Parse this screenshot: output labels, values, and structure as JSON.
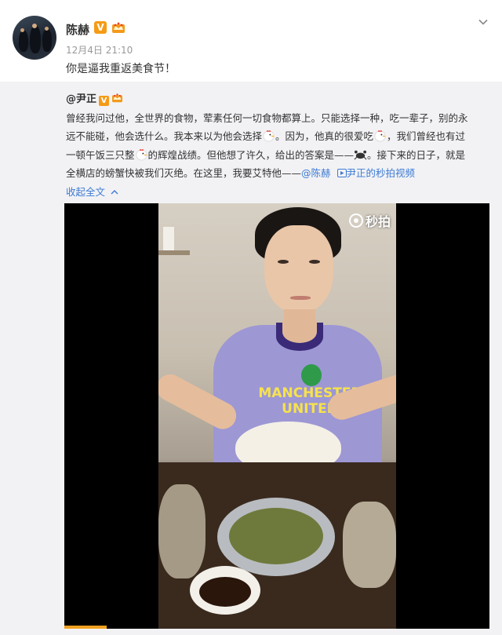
{
  "post": {
    "username": "陈赫",
    "verified_badge": "V",
    "time": "12月4日 21:10",
    "text": "你是逼我重返美食节！"
  },
  "repost": {
    "author": "@尹正",
    "verified_badge": "V",
    "line1": "曾经我问过他，全世界的食物，荤素任何一切食物都算上。只能选择一种，吃一辈子，别的永",
    "line2_a": "远不能碰，他会选什么。我本来以为他会选择",
    "line2_b": "。因为，他真的很爱吃",
    "line2_c": "，我们曾经也有过",
    "line3_a": "一顿午饭三只整",
    "line3_b": "的辉煌战绩。但他想了许久，给出的答案是——",
    "line3_c": "。接下来的日子，就是",
    "line4_a": "全横店的螃蟹快被我们灭绝。在这里，我要艾特他——",
    "mention": "@陈赫",
    "video_link": "尹正的秒拍视频",
    "collapse_label": "收起全文",
    "video_watermark": "秒拍",
    "video_progress": 0.1
  },
  "colors": {
    "accent": "#eb7350",
    "link": "#3e7bd3",
    "verified": "#f59b16",
    "repost_bg": "#f2f2f5"
  },
  "icons": {
    "chevron": "chevron-down-icon",
    "chicken": "chicken-emoji-icon",
    "crab": "crab-emoji-icon",
    "video": "video-link-icon"
  }
}
